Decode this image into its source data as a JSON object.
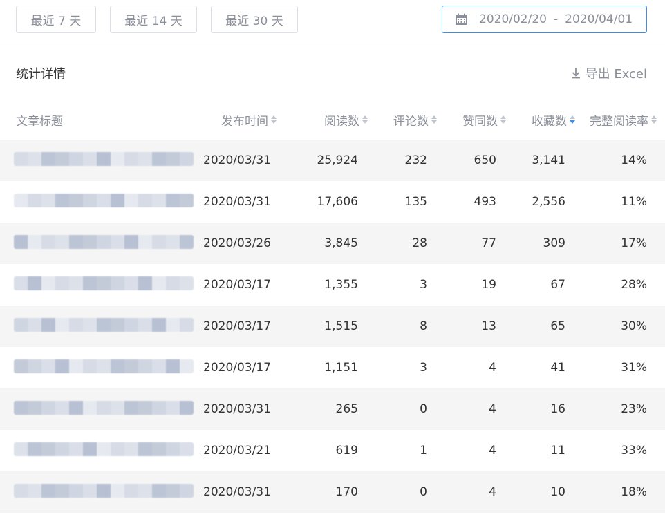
{
  "filters": {
    "last7": "最近 7 天",
    "last14": "最近 14 天",
    "last30": "最近 30 天",
    "date_start": "2020/02/20",
    "date_sep": "-",
    "date_end": "2020/04/01"
  },
  "section": {
    "title": "统计详情",
    "export_label": "导出 Excel"
  },
  "table": {
    "headers": {
      "title": "文章标题",
      "publish_time": "发布时间",
      "reads": "阅读数",
      "comments": "评论数",
      "likes": "赞同数",
      "favorites": "收藏数",
      "completion_rate": "完整阅读率"
    },
    "sorted_column": "favorites",
    "rows": [
      {
        "date": "2020/03/31",
        "reads": "25,924",
        "comments": "232",
        "likes": "650",
        "favorites": "3,141",
        "rate": "14%"
      },
      {
        "date": "2020/03/31",
        "reads": "17,606",
        "comments": "135",
        "likes": "493",
        "favorites": "2,556",
        "rate": "11%"
      },
      {
        "date": "2020/03/26",
        "reads": "3,845",
        "comments": "28",
        "likes": "77",
        "favorites": "309",
        "rate": "17%"
      },
      {
        "date": "2020/03/17",
        "reads": "1,355",
        "comments": "3",
        "likes": "19",
        "favorites": "67",
        "rate": "28%"
      },
      {
        "date": "2020/03/17",
        "reads": "1,515",
        "comments": "8",
        "likes": "13",
        "favorites": "65",
        "rate": "30%"
      },
      {
        "date": "2020/03/17",
        "reads": "1,151",
        "comments": "3",
        "likes": "4",
        "favorites": "41",
        "rate": "31%"
      },
      {
        "date": "2020/03/31",
        "reads": "265",
        "comments": "0",
        "likes": "4",
        "favorites": "16",
        "rate": "23%"
      },
      {
        "date": "2020/03/21",
        "reads": "619",
        "comments": "1",
        "likes": "4",
        "favorites": "11",
        "rate": "33%"
      },
      {
        "date": "2020/03/31",
        "reads": "170",
        "comments": "0",
        "likes": "4",
        "favorites": "10",
        "rate": "18%"
      }
    ]
  },
  "colors": {
    "accent": "#3a8ee6",
    "muted_text": "#8a8f99",
    "stripe": "#f5f5f5"
  },
  "icons": {
    "date": "calendar-icon",
    "export": "download-icon"
  }
}
